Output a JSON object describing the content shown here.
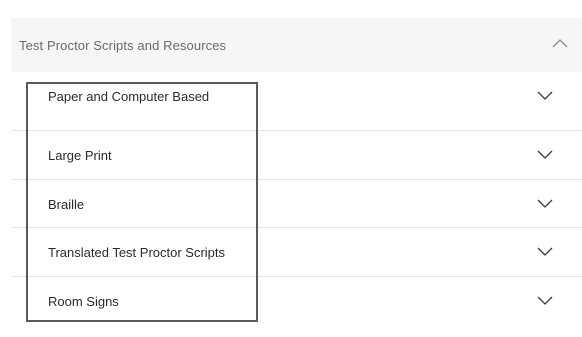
{
  "section": {
    "title": "Test Proctor Scripts and Resources",
    "expanded": true,
    "toggle_icon": "chevron-up-icon"
  },
  "items": [
    {
      "label": "Paper and Computer Based",
      "icon": "chevron-down-icon"
    },
    {
      "label": "Large Print",
      "icon": "chevron-down-icon"
    },
    {
      "label": "Braille",
      "icon": "chevron-down-icon"
    },
    {
      "label": "Translated Test Proctor Scripts",
      "icon": "chevron-down-icon"
    },
    {
      "label": "Room Signs",
      "icon": "chevron-down-icon"
    }
  ],
  "colors": {
    "header_bg": "#f6f6f6",
    "highlight_border": "#5a5a5a",
    "divider": "#e6e6e6"
  }
}
